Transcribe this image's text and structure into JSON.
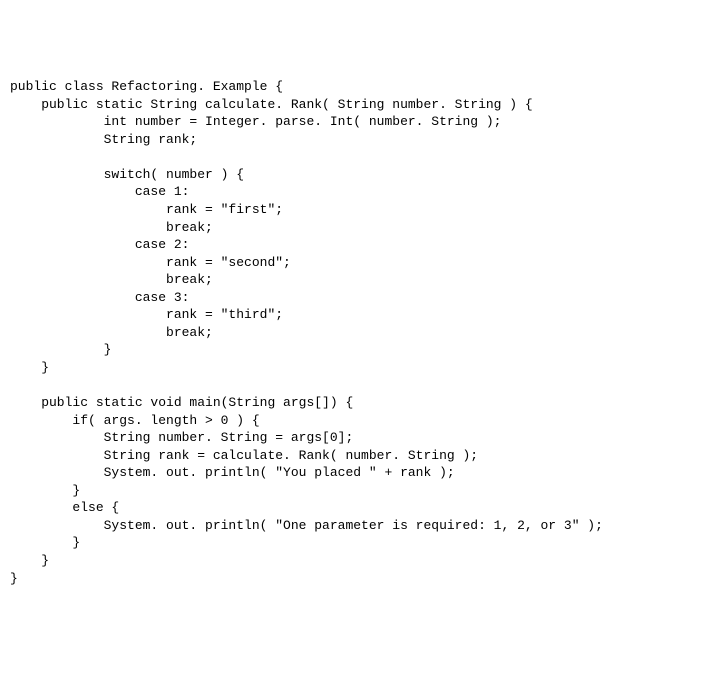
{
  "code": {
    "lines": [
      "public class Refactoring. Example {",
      "    public static String calculate. Rank( String number. String ) {",
      "            int number = Integer. parse. Int( number. String );",
      "            String rank;",
      "",
      "            switch( number ) {",
      "                case 1:",
      "                    rank = \"first\";",
      "                    break;",
      "                case 2:",
      "                    rank = \"second\";",
      "                    break;",
      "                case 3:",
      "                    rank = \"third\";",
      "                    break;",
      "            }",
      "    }",
      "",
      "    public static void main(String args[]) {",
      "        if( args. length > 0 ) {",
      "            String number. String = args[0];",
      "            String rank = calculate. Rank( number. String );",
      "            System. out. println( \"You placed \" + rank );",
      "        }",
      "        else {",
      "            System. out. println( \"One parameter is required: 1, 2, or 3\" );",
      "        }",
      "    }",
      "}"
    ]
  }
}
